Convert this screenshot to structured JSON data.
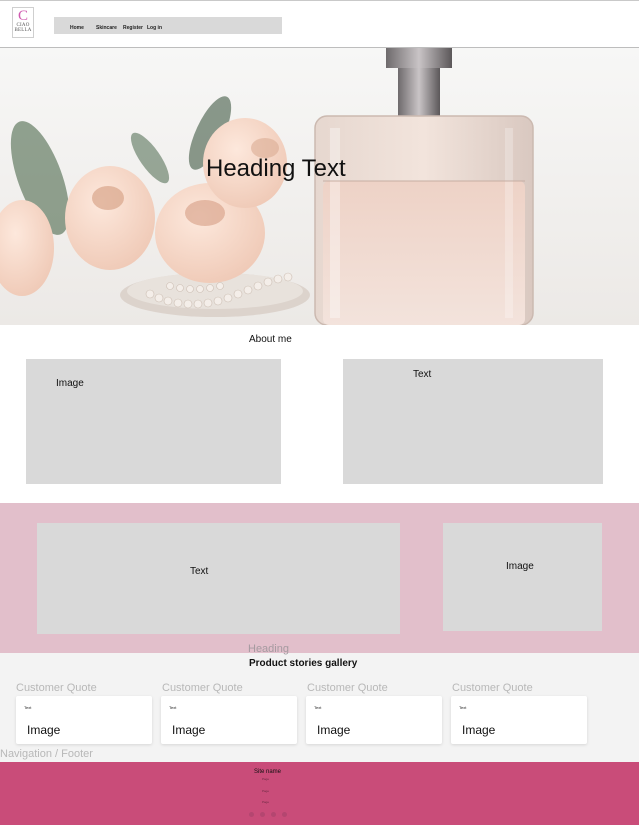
{
  "header": {
    "logo": {
      "letter": "C",
      "line1": "CIAO",
      "line2": "BELLA"
    },
    "nav": [
      "Home",
      "Skincare",
      "Register",
      "Log in"
    ]
  },
  "hero": {
    "heading": "Heading Text"
  },
  "about": {
    "title": "About me",
    "image_label": "Image",
    "text_label": "Text"
  },
  "band": {
    "text_label": "Text",
    "image_label": "Image"
  },
  "gallery": {
    "layer_label": "Heading",
    "title": "Product stories gallery",
    "quote_label": "Customer Quote",
    "cards": [
      {
        "text": "Text",
        "image": "Image"
      },
      {
        "text": "Text",
        "image": "Image"
      },
      {
        "text": "Text",
        "image": "Image"
      },
      {
        "text": "Text",
        "image": "Image"
      }
    ]
  },
  "footer_layer_label": "Navigation / Footer",
  "footer": {
    "site_name": "Site name",
    "pages": [
      "Page",
      "Page",
      "Page"
    ]
  }
}
